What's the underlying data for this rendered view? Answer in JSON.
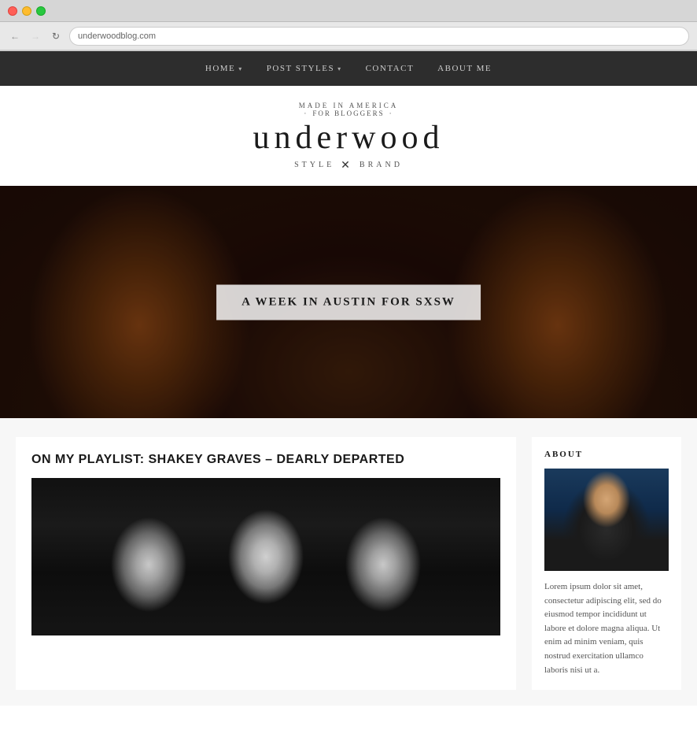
{
  "browser": {
    "address": "underwoodblog.com"
  },
  "nav": {
    "items": [
      {
        "label": "HOME",
        "hasArrow": true
      },
      {
        "label": "POST STYLES",
        "hasArrow": true
      },
      {
        "label": "CONTACT",
        "hasArrow": false
      },
      {
        "label": "ABOUT ME",
        "hasArrow": false
      }
    ]
  },
  "header": {
    "tagline_top": "MADE IN AMERICA",
    "for_bloggers": "FOR BLOGGERS",
    "title": "underwood",
    "style": "STYLE",
    "brand": "BRAND"
  },
  "hero": {
    "label": "A WEEK IN AUSTIN FOR SXSW"
  },
  "post": {
    "title": "ON MY PLAYLIST: SHAKEY GRAVES – DEARLY DEPARTED"
  },
  "sidebar": {
    "about_title": "ABOUT",
    "about_text": "Lorem ipsum dolor sit amet, consectetur adipiscing elit, sed do eiusmod tempor incididunt ut labore et dolore magna aliqua. Ut enim ad minim veniam, quis nostrud exercitation ullamco laboris nisi ut a."
  }
}
